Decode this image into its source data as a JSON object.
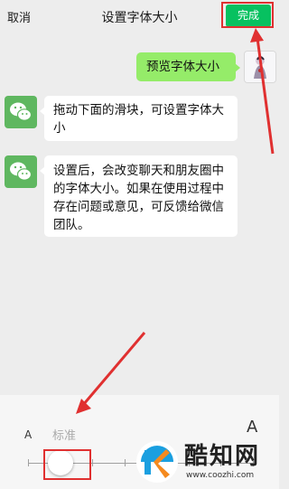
{
  "header": {
    "cancel_label": "取消",
    "title": "设置字体大小",
    "done_label": "完成"
  },
  "messages": [
    {
      "sender": "user",
      "text": "预览字体大小"
    },
    {
      "sender": "wechat",
      "text": "拖动下面的滑块，可设置字体大小"
    },
    {
      "sender": "wechat",
      "text": "设置后，会改变聊天和朋友圈中的字体大小。如果在使用过程中存在问题或意见，可反馈给微信团队。"
    }
  ],
  "slider": {
    "min_label": "A",
    "max_label": "A",
    "current_label": "标准",
    "current_step": 1,
    "step_count": 8
  },
  "watermark": {
    "brand": "酷知网",
    "url": "www.coozhi.com"
  },
  "colors": {
    "accent": "#07c160",
    "highlight": "#e03030",
    "bubble_green": "#95ec69",
    "background": "#ededed"
  },
  "icons": [
    "wechat-logo-icon",
    "user-avatar-icon",
    "coozhi-logo-icon"
  ]
}
